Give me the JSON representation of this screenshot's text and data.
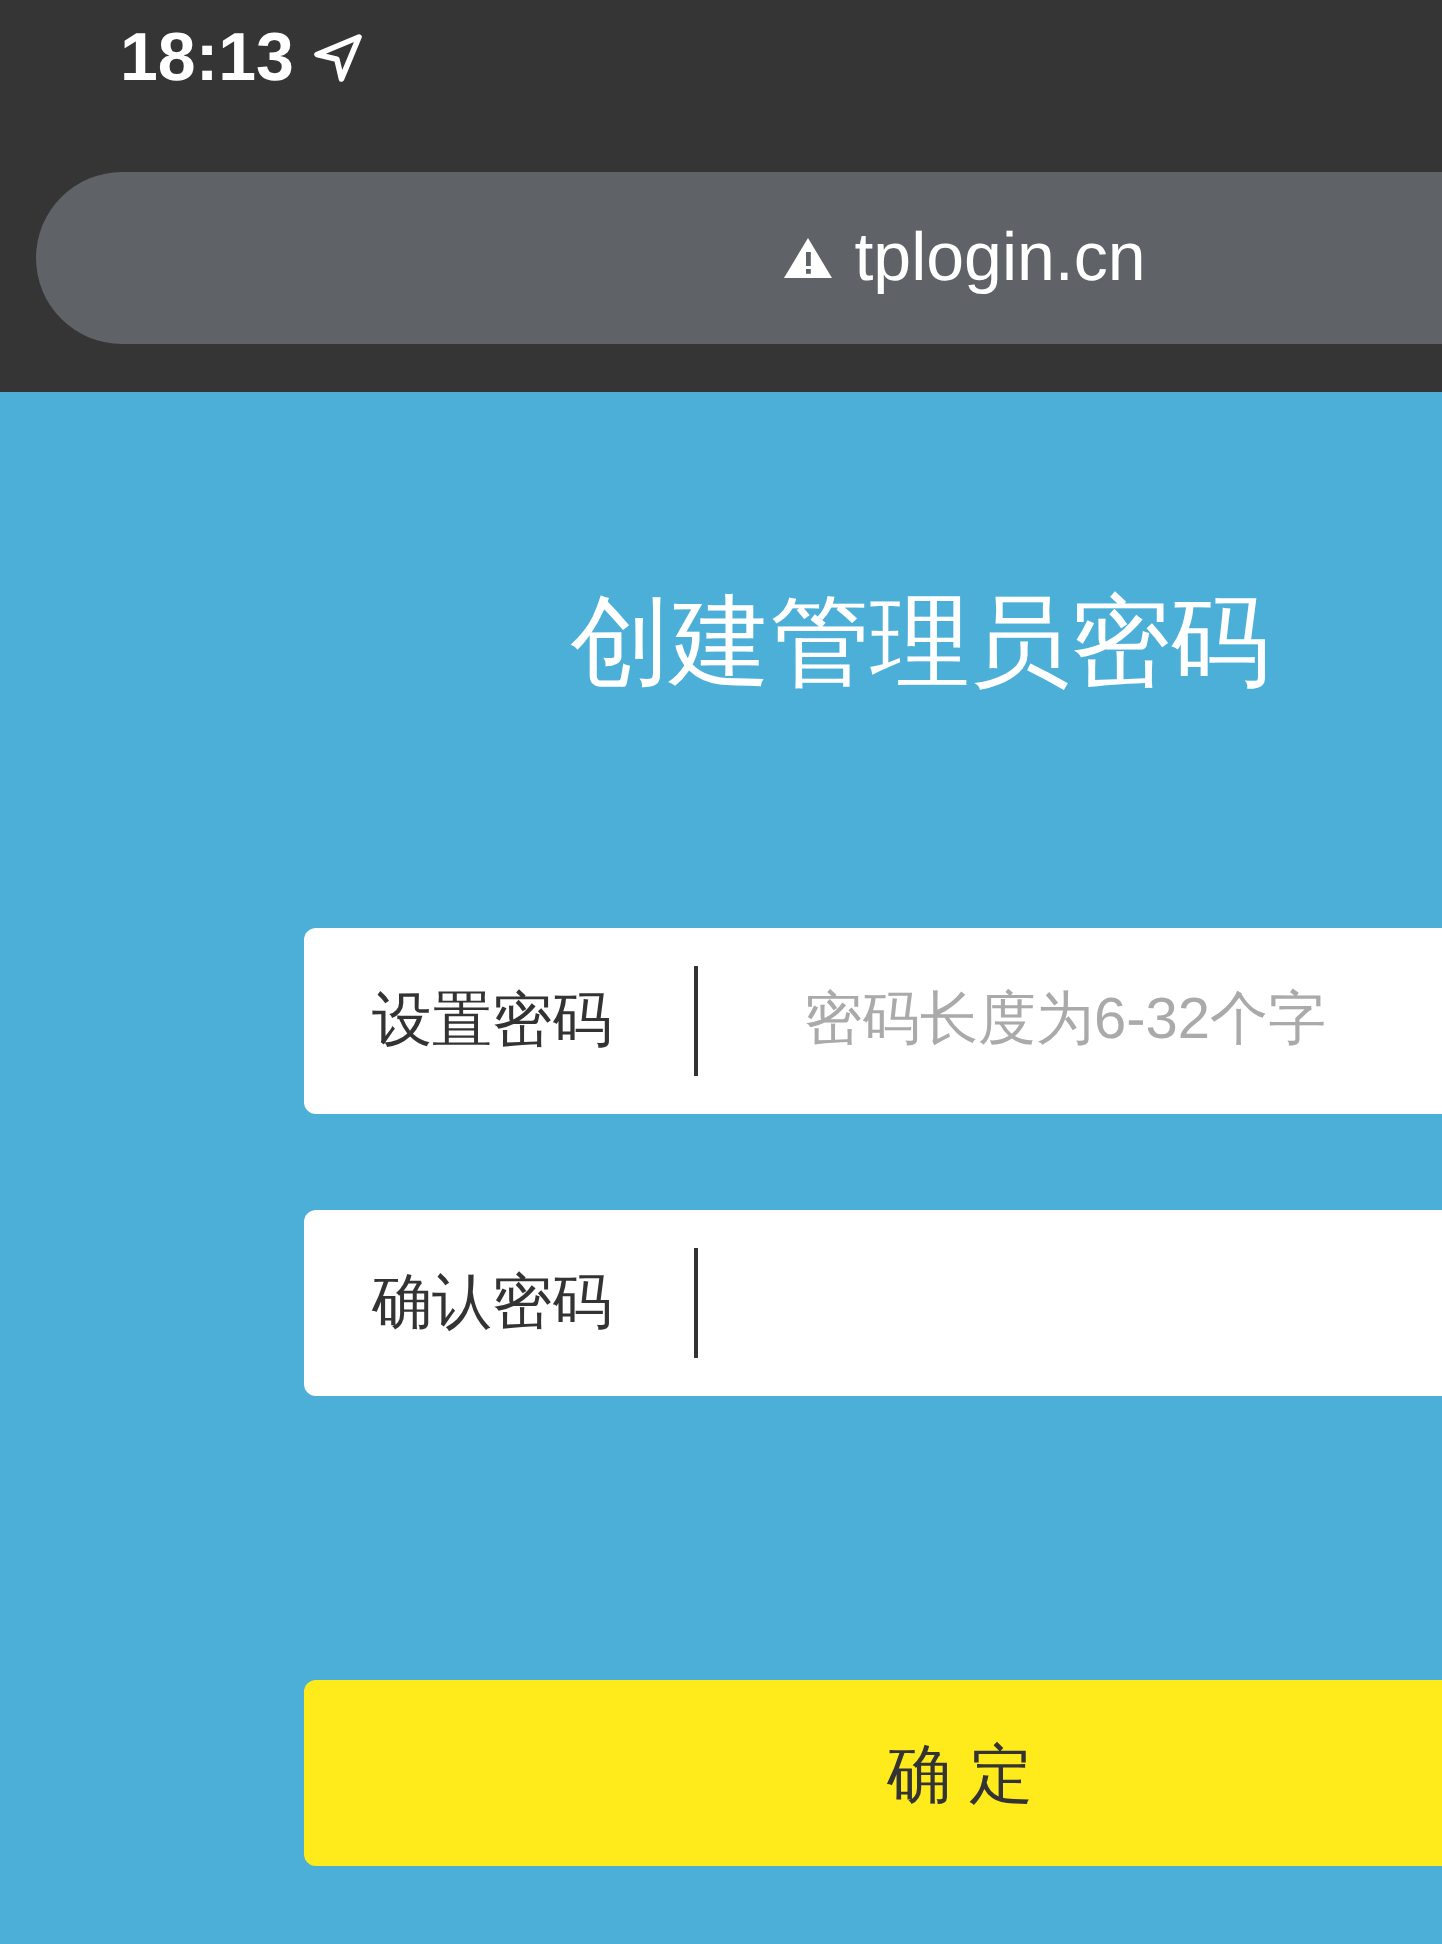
{
  "status_bar": {
    "time": "18:13"
  },
  "address_bar": {
    "url": "tplogin.cn"
  },
  "title": "创建管理员密码",
  "fields": [
    {
      "label": "设置密码",
      "placeholder": "密码长度为6-32个字"
    },
    {
      "label": "确认密码"
    }
  ],
  "button": "确 定"
}
